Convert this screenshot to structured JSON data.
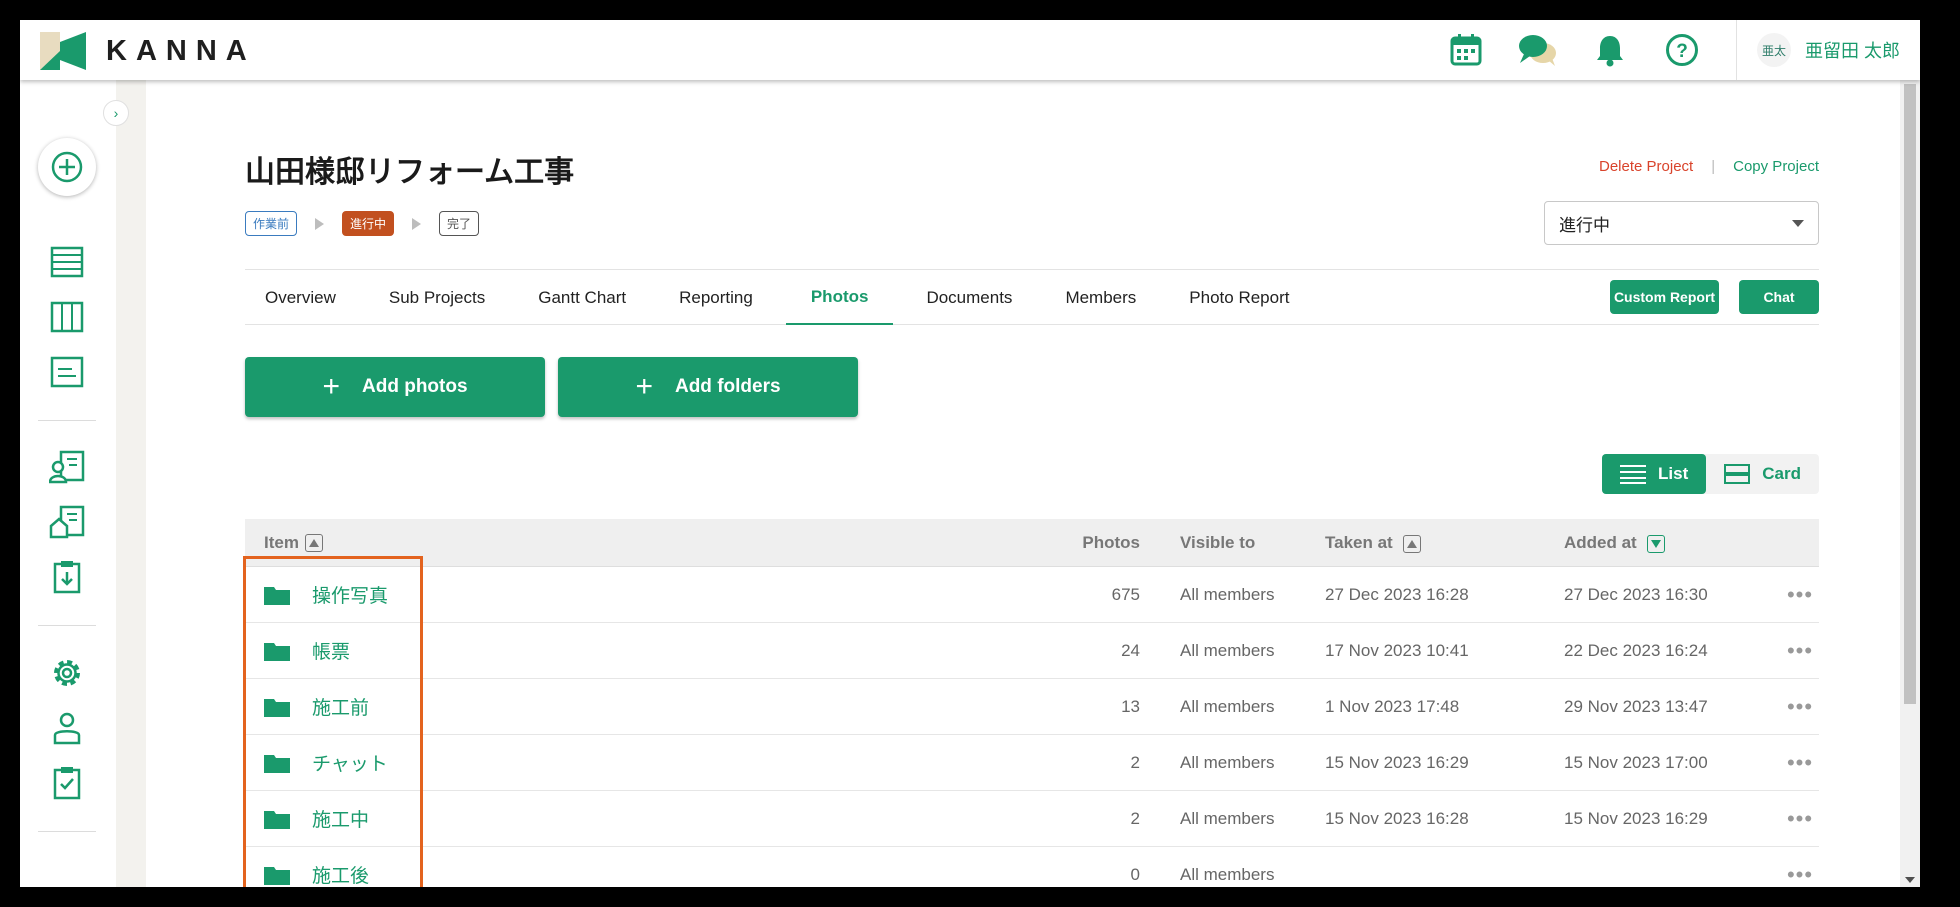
{
  "app": {
    "logo_text": "KANNA",
    "user": {
      "avatar_text": "亜太",
      "name": "亜留田 太郎"
    },
    "top_icons": [
      "calendar-icon",
      "chat-bubbles-icon",
      "bell-icon",
      "help-icon"
    ],
    "colors": {
      "brand": "#1a9a6c",
      "danger": "#d9432b",
      "in_progress": "#c2501f",
      "highlight": "#e3631e"
    }
  },
  "rail": {
    "toggle": "›",
    "items": [
      "add-circle-icon",
      "list-icon",
      "board-icon",
      "document-icon",
      "client-icon",
      "property-icon",
      "download-clipboard-icon",
      "settings-icon",
      "user-icon",
      "checklist-icon"
    ]
  },
  "project": {
    "title": "山田様邸リフォーム工事",
    "delete_label": "Delete Project",
    "separator": "|",
    "copy_label": "Copy Project",
    "steps": [
      "作業前",
      "進行中",
      "完了"
    ],
    "status_value": "進行中"
  },
  "tabs": [
    "Overview",
    "Sub Projects",
    "Gantt Chart",
    "Reporting",
    "Photos",
    "Documents",
    "Members",
    "Photo Report"
  ],
  "active_tab": "Photos",
  "tab_buttons": {
    "custom_report": "Custom Report",
    "chat": "Chat"
  },
  "add_buttons": {
    "add_photos": "Add photos",
    "add_folders": "Add folders"
  },
  "view_toggle": {
    "list": "List",
    "card": "Card",
    "selected": "List"
  },
  "table": {
    "headers": {
      "item": "Item",
      "photos": "Photos",
      "visible_to": "Visible to",
      "taken_at": "Taken at",
      "added_at": "Added at"
    },
    "rows": [
      {
        "name": "操作写真",
        "photos": "675",
        "visible_to": "All members",
        "taken_at": "27 Dec 2023 16:28",
        "added_at": "27 Dec 2023 16:30"
      },
      {
        "name": "帳票",
        "photos": "24",
        "visible_to": "All members",
        "taken_at": "17 Nov 2023 10:41",
        "added_at": "22 Dec 2023 16:24"
      },
      {
        "name": "施工前",
        "photos": "13",
        "visible_to": "All members",
        "taken_at": "1 Nov 2023 17:48",
        "added_at": "29 Nov 2023 13:47"
      },
      {
        "name": "チャット",
        "photos": "2",
        "visible_to": "All members",
        "taken_at": "15 Nov 2023 16:29",
        "added_at": "15 Nov 2023 17:00"
      },
      {
        "name": "施工中",
        "photos": "2",
        "visible_to": "All members",
        "taken_at": "15 Nov 2023 16:28",
        "added_at": "15 Nov 2023 16:29"
      },
      {
        "name": "施工後",
        "photos": "0",
        "visible_to": "All members",
        "taken_at": "",
        "added_at": ""
      }
    ],
    "more_glyph": "•••"
  }
}
